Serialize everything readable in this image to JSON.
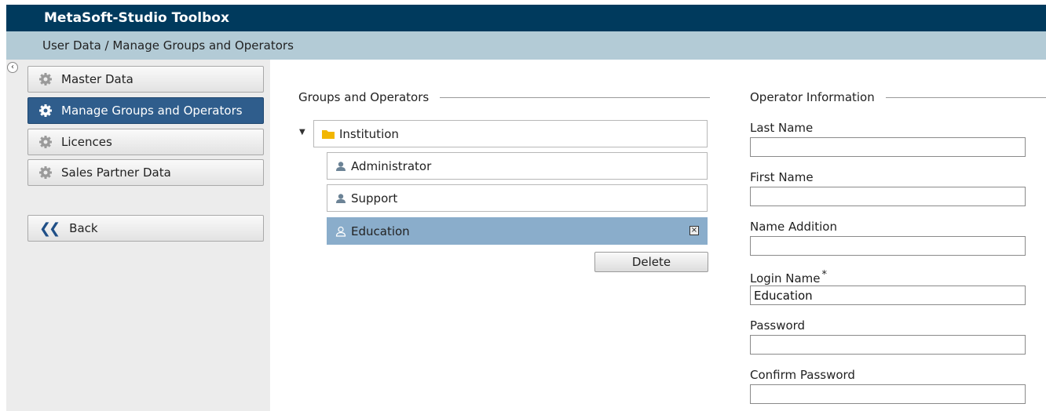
{
  "app": {
    "title": "MetaSoft-Studio Toolbox"
  },
  "breadcrumb": "User Data  /  Manage Groups and Operators",
  "sidebar": {
    "items": [
      {
        "label": "Master Data",
        "icon": "gear-icon",
        "active": false
      },
      {
        "label": "Manage Groups and Operators",
        "icon": "gear-icon",
        "active": true
      },
      {
        "label": "Licences",
        "icon": "gear-icon",
        "active": false
      },
      {
        "label": "Sales Partner Data",
        "icon": "gear-icon",
        "active": false
      }
    ],
    "back_label": "Back"
  },
  "groups": {
    "title": "Groups and Operators",
    "root": {
      "label": "Institution",
      "icon": "folder-icon"
    },
    "operators": [
      {
        "label": "Administrator",
        "icon": "user-icon"
      },
      {
        "label": "Support",
        "icon": "user-icon"
      },
      {
        "label": "Education",
        "icon": "user-icon",
        "selected": true
      }
    ],
    "delete_label": "Delete"
  },
  "operator": {
    "title": "Operator Information",
    "fields": {
      "last_name": {
        "label": "Last Name",
        "value": ""
      },
      "first_name": {
        "label": "First Name",
        "value": ""
      },
      "name_addition": {
        "label": "Name Addition",
        "value": ""
      },
      "login_name": {
        "label": "Login Name",
        "required_mark": "*",
        "value": "Education"
      },
      "password": {
        "label": "Password",
        "value": ""
      },
      "confirm_password": {
        "label": "Confirm Password",
        "value": ""
      }
    }
  },
  "colors": {
    "header": "#003a5d",
    "breadcrumb": "#b3cbd6",
    "active_nav": "#2f5d8c",
    "selected_row": "#8aadcb",
    "folder": "#f2b600"
  }
}
